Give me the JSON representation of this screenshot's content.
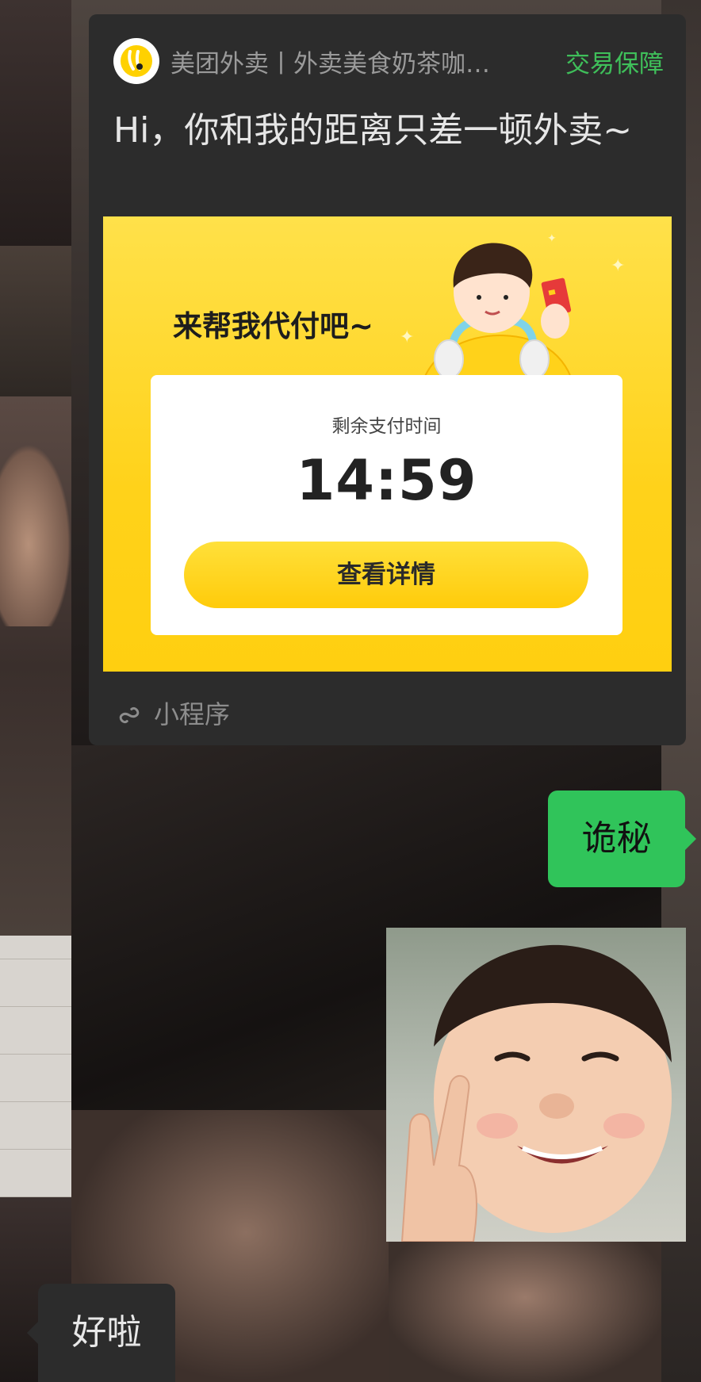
{
  "app": {
    "name": "美团外卖丨外卖美食奶茶咖…",
    "guarantee_label": "交易保障",
    "logo_icon": "meituan-kangaroo-logo"
  },
  "card": {
    "message": "Hi，你和我的距离只差一顿外卖~",
    "banner": {
      "title": "来帮我代付吧~",
      "remaining_label": "剩余支付时间",
      "countdown": "14:59",
      "button_label": "查看详情"
    },
    "footer_label": "小程序",
    "footer_icon": "mini-program-icon"
  },
  "messages": {
    "sent": "诡秘",
    "received": "好啦"
  },
  "colors": {
    "accent_green": "#30c45a",
    "guarantee_green": "#3fbf5a",
    "brand_yellow": "#ffd21a",
    "card_bg": "#2c2c2c"
  }
}
